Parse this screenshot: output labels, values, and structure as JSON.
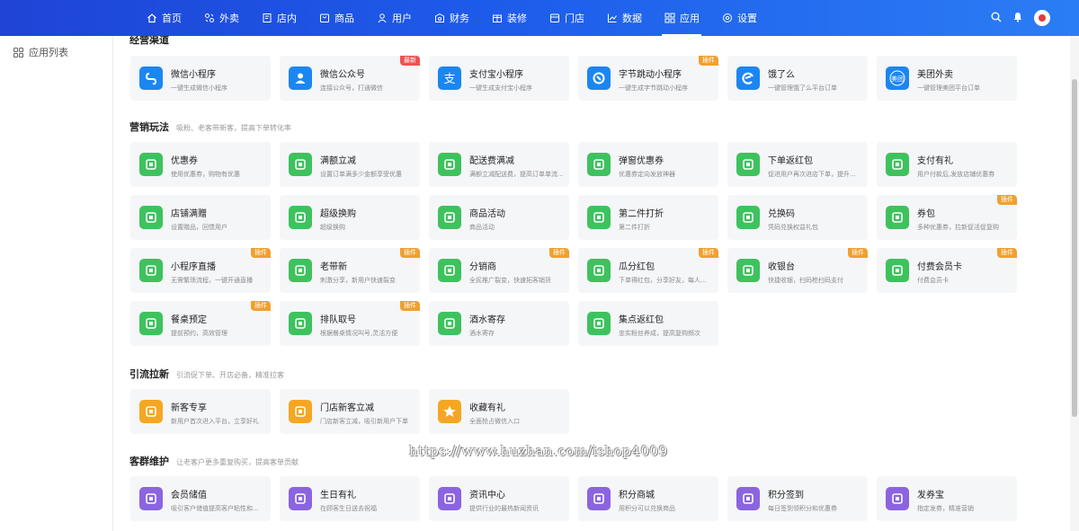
{
  "nav": {
    "items": [
      {
        "label": "首页",
        "icon": "home-icon"
      },
      {
        "label": "外卖",
        "icon": "takeout-icon"
      },
      {
        "label": "店内",
        "icon": "dinein-icon"
      },
      {
        "label": "商品",
        "icon": "goods-icon"
      },
      {
        "label": "用户",
        "icon": "user-icon"
      },
      {
        "label": "财务",
        "icon": "finance-icon"
      },
      {
        "label": "装修",
        "icon": "decorate-icon"
      },
      {
        "label": "门店",
        "icon": "store-icon"
      },
      {
        "label": "数据",
        "icon": "chart-icon"
      },
      {
        "label": "应用",
        "icon": "apps-icon"
      },
      {
        "label": "设置",
        "icon": "settings-icon"
      }
    ],
    "active_index": 9
  },
  "sidebar": {
    "items": [
      {
        "label": "应用列表",
        "icon": "grid-icon"
      }
    ]
  },
  "sections": [
    {
      "title": "经营渠道",
      "desc": "",
      "cards": [
        {
          "name": "微信小程序",
          "desc": "一键生成微信小程序",
          "color": "#1c86f0",
          "icon": "miniprogram-icon",
          "badge": ""
        },
        {
          "name": "微信公众号",
          "desc": "连接公众号，打通微信",
          "color": "#1c86f0",
          "icon": "official-account-icon",
          "badge": "最新"
        },
        {
          "name": "支付宝小程序",
          "desc": "一键生成支付宝小程序",
          "color": "#1c86f0",
          "icon": "alipay-icon",
          "badge": ""
        },
        {
          "name": "字节跳动小程序",
          "desc": "一键生成字节跳动小程序",
          "color": "#1c86f0",
          "icon": "bytedance-icon",
          "badge": "插件"
        },
        {
          "name": "饿了么",
          "desc": "一键管理饿了么平台订单",
          "color": "#1c86f0",
          "icon": "eleme-icon",
          "badge": ""
        },
        {
          "name": "美团外卖",
          "desc": "一键管理美团平台订单",
          "color": "#1c86f0",
          "icon": "meituan-icon",
          "badge": ""
        }
      ]
    },
    {
      "title": "营销玩法",
      "desc": "吸粉、老客带新客，提高下单转化率",
      "cards": [
        {
          "name": "优惠券",
          "desc": "使用优惠券，购物有优惠",
          "color": "#3ec25e",
          "icon": "coupon-icon",
          "badge": ""
        },
        {
          "name": "满额立减",
          "desc": "设置订单满多少金额享受优惠",
          "color": "#3ec25e",
          "icon": "full-reduction-icon",
          "badge": ""
        },
        {
          "name": "配送费满减",
          "desc": "满额立减配送费，提高订单单流...",
          "color": "#3ec25e",
          "icon": "delivery-fee-icon",
          "badge": ""
        },
        {
          "name": "弹窗优惠券",
          "desc": "优惠券定向发放神器",
          "color": "#3ec25e",
          "icon": "popup-coupon-icon",
          "badge": ""
        },
        {
          "name": "下单返红包",
          "desc": "促进用户再次进店下单，提升...",
          "color": "#3ec25e",
          "icon": "red-packet-icon",
          "badge": ""
        },
        {
          "name": "支付有礼",
          "desc": "用户付款后,发放店铺优惠券",
          "color": "#3ec25e",
          "icon": "pay-gift-icon",
          "badge": ""
        },
        {
          "name": "店铺满赠",
          "desc": "设置赠品，回馈用户",
          "color": "#3ec25e",
          "icon": "gift-icon",
          "badge": ""
        },
        {
          "name": "超级换购",
          "desc": "超级换购",
          "color": "#3ec25e",
          "icon": "exchange-icon",
          "badge": ""
        },
        {
          "name": "商品活动",
          "desc": "商品活动",
          "color": "#3ec25e",
          "icon": "activity-icon",
          "badge": ""
        },
        {
          "name": "第二件打折",
          "desc": "第二件打折",
          "color": "#3ec25e",
          "icon": "discount-icon",
          "badge": ""
        },
        {
          "name": "兑换码",
          "desc": "凭码兑换权益礼包",
          "color": "#3ec25e",
          "icon": "redeem-code-icon",
          "badge": ""
        },
        {
          "name": "券包",
          "desc": "多种优惠券，拉新促活促复购",
          "color": "#3ec25e",
          "icon": "coupon-pack-icon",
          "badge": "插件"
        },
        {
          "name": "小程序直播",
          "desc": "无需繁琐流程，一键开通直播",
          "color": "#3ec25e",
          "icon": "live-icon",
          "badge": "插件"
        },
        {
          "name": "老带新",
          "desc": "刺激分享，新用户快速裂变",
          "color": "#3ec25e",
          "icon": "invite-icon",
          "badge": "插件"
        },
        {
          "name": "分销商",
          "desc": "全民推广裂变，快速拓客销货",
          "color": "#3ec25e",
          "icon": "distributor-icon",
          "badge": "插件"
        },
        {
          "name": "瓜分红包",
          "desc": "下单得红包，分享好友，每人...",
          "color": "#3ec25e",
          "icon": "split-red-packet-icon",
          "badge": "插件"
        },
        {
          "name": "收银台",
          "desc": "快捷收银，扫码枪扫码支付",
          "color": "#3ec25e",
          "icon": "cashier-icon",
          "badge": "插件"
        },
        {
          "name": "付费会员卡",
          "desc": "付费会员卡",
          "color": "#3ec25e",
          "icon": "member-card-icon",
          "badge": "插件"
        },
        {
          "name": "餐桌预定",
          "desc": "提前预约，高效管理",
          "color": "#3ec25e",
          "icon": "table-reserve-icon",
          "badge": "插件"
        },
        {
          "name": "排队取号",
          "desc": "根据餐桌情况叫号,灵活方便",
          "color": "#3ec25e",
          "icon": "queue-icon",
          "badge": "插件"
        },
        {
          "name": "酒水寄存",
          "desc": "酒水寄存",
          "color": "#3ec25e",
          "icon": "storage-icon",
          "badge": ""
        },
        {
          "name": "集点返红包",
          "desc": "忠实粉丝养成，提高复购频次",
          "color": "#3ec25e",
          "icon": "points-red-packet-icon",
          "badge": ""
        }
      ]
    },
    {
      "title": "引流拉新",
      "desc": "引流促下单、开店必备，精准拉客",
      "cards": [
        {
          "name": "新客专享",
          "desc": "新用户首次进入平台，立享好礼",
          "color": "#f5a623",
          "icon": "new-customer-icon",
          "badge": ""
        },
        {
          "name": "门店新客立减",
          "desc": "门店新客立减，吸引新用户下单",
          "color": "#f5a623",
          "icon": "store-new-icon",
          "badge": ""
        },
        {
          "name": "收藏有礼",
          "desc": "全面抢占微信入口",
          "color": "#f5a623",
          "icon": "star-icon",
          "badge": ""
        }
      ]
    },
    {
      "title": "客群维护",
      "desc": "让老客户更多重复购买，提高客单贡献",
      "cards": [
        {
          "name": "会员储值",
          "desc": "吸引客户储值提高客户粘性和...",
          "color": "#8b64e0",
          "icon": "wallet-icon",
          "badge": ""
        },
        {
          "name": "生日有礼",
          "desc": "在顾客生日送去祝福",
          "color": "#8b64e0",
          "icon": "cake-icon",
          "badge": ""
        },
        {
          "name": "资讯中心",
          "desc": "提供行业的最热新闻资讯",
          "color": "#8b64e0",
          "icon": "news-icon",
          "badge": ""
        },
        {
          "name": "积分商城",
          "desc": "用积分可以兑换商品",
          "color": "#8b64e0",
          "icon": "points-mall-icon",
          "badge": ""
        },
        {
          "name": "积分签到",
          "desc": "每日签到领积分和优惠券",
          "color": "#8b64e0",
          "icon": "checkin-icon",
          "badge": ""
        },
        {
          "name": "发券宝",
          "desc": "指定发券，精准营销",
          "color": "#8b64e0",
          "icon": "coupon-sender-icon",
          "badge": ""
        }
      ]
    }
  ],
  "watermark": "https://www.huzhan.com/ishop4009"
}
